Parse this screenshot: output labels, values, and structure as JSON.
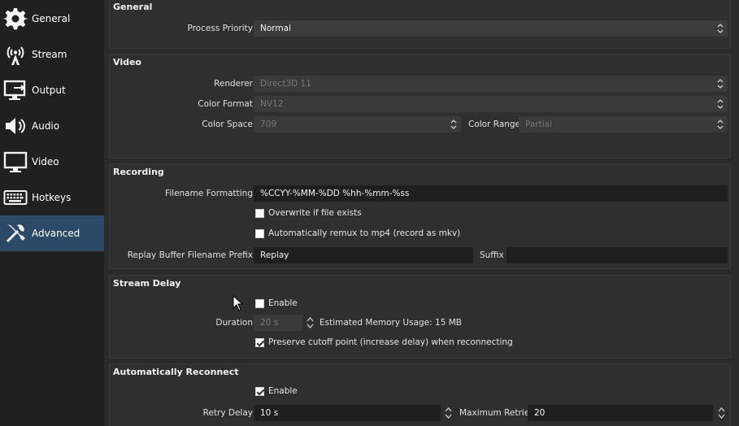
{
  "sidebar": {
    "items": [
      {
        "label": "General",
        "icon": "gear-icon"
      },
      {
        "label": "Stream",
        "icon": "broadcast-antenna-icon"
      },
      {
        "label": "Output",
        "icon": "monitor-output-icon"
      },
      {
        "label": "Audio",
        "icon": "speaker-icon"
      },
      {
        "label": "Video",
        "icon": "monitor-icon"
      },
      {
        "label": "Hotkeys",
        "icon": "keyboard-icon"
      },
      {
        "label": "Advanced",
        "icon": "tools-icon",
        "active": true
      }
    ]
  },
  "general": {
    "title": "General",
    "process_priority_label": "Process Priority",
    "process_priority_value": "Normal"
  },
  "video": {
    "title": "Video",
    "renderer_label": "Renderer",
    "renderer_value": "Direct3D 11",
    "color_format_label": "Color Format",
    "color_format_value": "NV12",
    "color_space_label": "Color Space",
    "color_space_value": "709",
    "color_range_label": "Color Range",
    "color_range_value": "Partial"
  },
  "recording": {
    "title": "Recording",
    "filename_formatting_label": "Filename Formatting",
    "filename_formatting_value": "%CCYY-%MM-%DD %hh-%mm-%ss",
    "overwrite_label": "Overwrite if file exists",
    "overwrite_checked": false,
    "remux_label": "Automatically remux to mp4 (record as mkv)",
    "remux_checked": false,
    "replay_prefix_label": "Replay Buffer Filename Prefix",
    "replay_prefix_value": "Replay",
    "suffix_label": "Suffix",
    "suffix_value": ""
  },
  "stream_delay": {
    "title": "Stream Delay",
    "enable_label": "Enable",
    "enable_checked": false,
    "duration_label": "Duration",
    "duration_value": "20 s",
    "memory_usage": "Estimated Memory Usage: 15 MB",
    "preserve_label": "Preserve cutoff point (increase delay) when reconnecting",
    "preserve_checked": true
  },
  "auto_reconnect": {
    "title": "Automatically Reconnect",
    "enable_label": "Enable",
    "enable_checked": true,
    "retry_delay_label": "Retry Delay",
    "retry_delay_value": "10 s",
    "max_retries_label": "Maximum Retries",
    "max_retries_value": "20"
  },
  "colors": {
    "sidebar_bg": "#202020",
    "active_nav_bg": "#2c4a68",
    "content_bg": "#2b2b2b",
    "field_bg": "#1f1f1f"
  }
}
